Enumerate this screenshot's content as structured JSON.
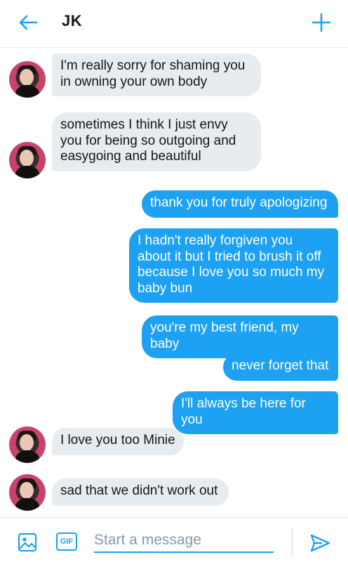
{
  "header": {
    "title": "JK",
    "back_icon": "arrow-left-icon",
    "add_icon": "plus-icon",
    "accent_color": "#1da1f2"
  },
  "messages": [
    {
      "direction": "in",
      "text_lines": [
        "I'm really sorry for shaming you",
        "in owning your own body"
      ]
    },
    {
      "direction": "in",
      "text_lines": [
        "sometimes I think I just envy",
        "you for being so outgoing and",
        "easygoing and beautiful"
      ]
    },
    {
      "direction": "out",
      "text_lines": [
        "thank you for truly apologizing"
      ]
    },
    {
      "direction": "out",
      "text_lines": [
        "I hadn't really forgiven you",
        "about it but I tried to brush it off",
        "because I love you so much my",
        "baby bun"
      ]
    },
    {
      "direction": "out",
      "text_lines": [
        "you're my best friend, my baby"
      ]
    },
    {
      "direction": "out",
      "text_lines": [
        "never forget that"
      ]
    },
    {
      "direction": "out",
      "text_lines": [
        "I'll always be here for you"
      ]
    },
    {
      "direction": "in",
      "text_lines": [
        "I love you too Minie"
      ]
    },
    {
      "direction": "in",
      "text_lines": [
        "sad that we didn't work out"
      ]
    }
  ],
  "composer": {
    "placeholder": "Start a message",
    "gif_label": "GIF",
    "image_icon": "image-icon",
    "send_icon": "send-icon"
  },
  "colors": {
    "incoming_bubble": "#e6ecf0",
    "outgoing_bubble": "#1da1f2",
    "incoming_text": "#14171a",
    "outgoing_text": "#ffffff"
  }
}
